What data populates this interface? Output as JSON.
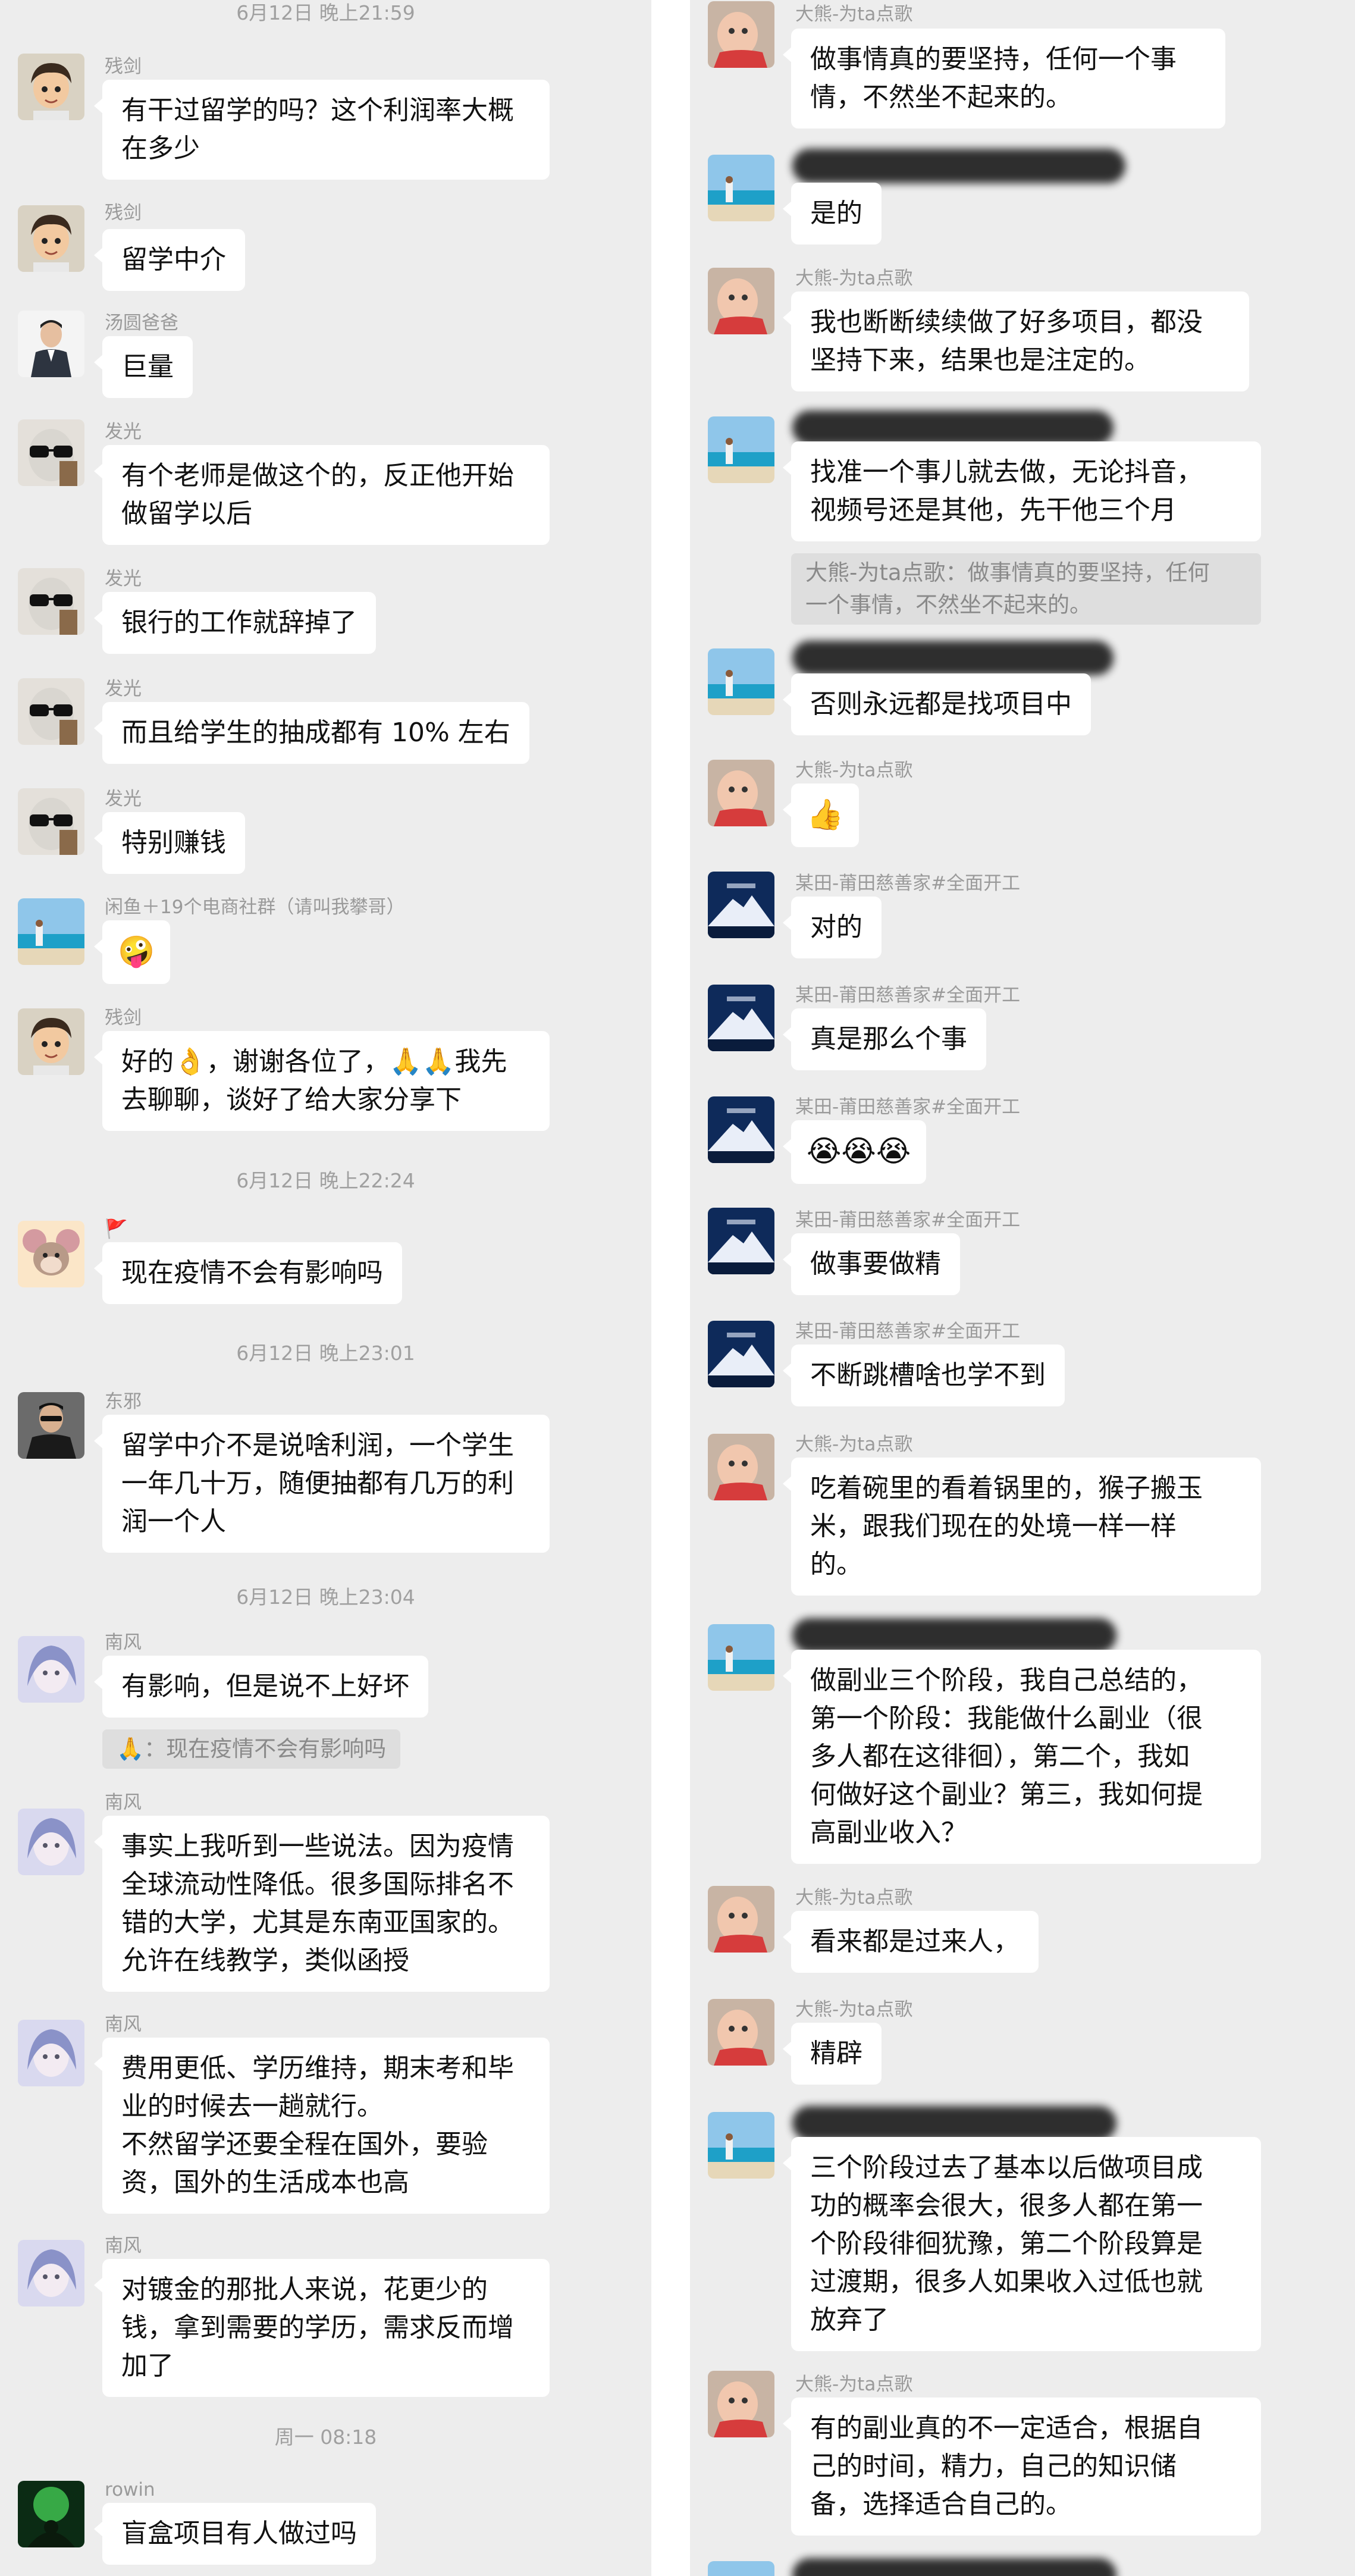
{
  "colors": {
    "background": "#ededed",
    "bubble": "#ffffff",
    "timestamp": "#a0a0a0",
    "name": "#9a9a9a",
    "quote_bg": "#dedede"
  },
  "left": {
    "timestamps": [
      "6月12日 晚上21:59",
      "6月12日 晚上22:24",
      "6月12日 晚上23:01",
      "6月12日 晚上23:04",
      "周一 08:18"
    ],
    "messages": [
      {
        "sender": "残剑",
        "avatar": "cartoon-boy-avatar",
        "lines": [
          "有干过留学的吗？这个利润率大概",
          "在多少"
        ]
      },
      {
        "sender": "残剑",
        "avatar": "cartoon-boy-avatar",
        "lines": [
          "留学中介"
        ]
      },
      {
        "sender": "汤圆爸爸",
        "avatar": "man-in-suit-avatar",
        "lines": [
          "巨量"
        ]
      },
      {
        "sender": "发光",
        "avatar": "sunglasses-avatar",
        "lines": [
          "有个老师是做这个的，反正他开始",
          "做留学以后"
        ]
      },
      {
        "sender": "发光",
        "avatar": "sunglasses-avatar",
        "lines": [
          "银行的工作就辞掉了"
        ]
      },
      {
        "sender": "发光",
        "avatar": "sunglasses-avatar",
        "lines": [
          "而且给学生的抽成都有 10% 左右"
        ]
      },
      {
        "sender": "发光",
        "avatar": "sunglasses-avatar",
        "lines": [
          "特别赚钱"
        ]
      },
      {
        "sender": "闲鱼＋19个电商社群（请叫我攀哥）",
        "avatar": "beach-avatar",
        "emoji": "🤪"
      },
      {
        "sender": "残剑",
        "avatar": "cartoon-boy-avatar",
        "lines": [
          "好的👌，谢谢各位了，🙏🙏我先",
          "去聊聊，谈好了给大家分享下"
        ]
      },
      {
        "sender": "🚩",
        "avatar": "cartoon-mouse-avatar",
        "lines": [
          "现在疫情不会有影响吗"
        ]
      },
      {
        "sender": "东邪",
        "avatar": "man-dark-avatar",
        "lines": [
          "留学中介不是说啥利润，一个学生",
          "一年几十万，随便抽都有几万的利",
          "润一个人"
        ]
      },
      {
        "sender": "南风",
        "avatar": "anime-girl-avatar",
        "lines": [
          "有影响，但是说不上好坏"
        ],
        "quote": "🙏：现在疫情不会有影响吗"
      },
      {
        "sender": "南风",
        "avatar": "anime-girl-avatar",
        "lines": [
          "事实上我听到一些说法。因为疫情",
          "全球流动性降低。很多国际排名不",
          "错的大学，尤其是东南亚国家的。",
          "允许在线教学，类似函授"
        ]
      },
      {
        "sender": "南风",
        "avatar": "anime-girl-avatar",
        "lines": [
          "费用更低、学历维持，期末考和毕",
          "业的时候去一趟就行。",
          "不然留学还要全程在国外，要验",
          "资，国外的生活成本也高"
        ]
      },
      {
        "sender": "南风",
        "avatar": "anime-girl-avatar",
        "lines": [
          "对镀金的那批人来说，花更少的",
          "钱，拿到需要的学历，需求反而增",
          "加了"
        ]
      },
      {
        "sender": "rowin",
        "avatar": "rowin-avatar",
        "lines": [
          "盲盒项目有人做过吗"
        ]
      }
    ]
  },
  "right": {
    "messages": [
      {
        "sender": "大熊-为ta点歌",
        "avatar": "baby-avatar",
        "lines": [
          "做事情真的要坚持，任何一个事",
          "情，不然坐不起来的。"
        ]
      },
      {
        "sender": "",
        "avatar": "beach-avatar",
        "lines": [
          "是的"
        ]
      },
      {
        "sender": "大熊-为ta点歌",
        "avatar": "baby-avatar",
        "lines": [
          "我也断断续续做了好多项目，都没",
          "坚持下来，结果也是注定的。"
        ]
      },
      {
        "sender": "",
        "avatar": "beach-avatar",
        "lines": [
          "找准一个事儿就去做，无论抖音，",
          "视频号还是其他，先干他三个月"
        ],
        "quote_lines": [
          "大熊-为ta点歌：做事情真的要坚持，任何",
          "一个事情，不然坐不起来的。"
        ]
      },
      {
        "sender": "",
        "avatar": "beach-avatar",
        "lines": [
          "否则永远都是找项目中"
        ]
      },
      {
        "sender": "大熊-为ta点歌",
        "avatar": "baby-avatar",
        "emoji": "👍"
      },
      {
        "sender": "某田-莆田慈善家#全面开工",
        "avatar": "mountain-avatar",
        "lines": [
          "对的"
        ]
      },
      {
        "sender": "某田-莆田慈善家#全面开工",
        "avatar": "mountain-avatar",
        "lines": [
          "真是那么个事"
        ]
      },
      {
        "sender": "某田-莆田慈善家#全面开工",
        "avatar": "mountain-avatar",
        "emoji": "😭😭😭"
      },
      {
        "sender": "某田-莆田慈善家#全面开工",
        "avatar": "mountain-avatar",
        "lines": [
          "做事要做精"
        ]
      },
      {
        "sender": "某田-莆田慈善家#全面开工",
        "avatar": "mountain-avatar",
        "lines": [
          "不断跳槽啥也学不到"
        ]
      },
      {
        "sender": "大熊-为ta点歌",
        "avatar": "baby-avatar",
        "lines": [
          "吃着碗里的看着锅里的，猴子搬玉",
          "米，跟我们现在的处境一样一样",
          "的。"
        ]
      },
      {
        "sender": "",
        "avatar": "beach-avatar",
        "lines": [
          "做副业三个阶段，我自己总结的，",
          "第一个阶段：我能做什么副业（很",
          "多人都在这徘徊），第二个，我如",
          "何做好这个副业？第三，我如何提",
          "高副业收入？"
        ]
      },
      {
        "sender": "大熊-为ta点歌",
        "avatar": "baby-avatar",
        "lines": [
          "看来都是过来人，"
        ]
      },
      {
        "sender": "大熊-为ta点歌",
        "avatar": "baby-avatar",
        "lines": [
          "精辟"
        ]
      },
      {
        "sender": "",
        "avatar": "beach-avatar",
        "lines": [
          "三个阶段过去了基本以后做项目成",
          "功的概率会很大，很多人都在第一",
          "个阶段徘徊犹豫，第二个阶段算是",
          "过渡期，很多人如果收入过低也就",
          "放弃了"
        ]
      },
      {
        "sender": "大熊-为ta点歌",
        "avatar": "baby-avatar",
        "lines": [
          "有的副业真的不一定适合，根据自",
          "己的时间，精力，自己的知识储",
          "备，选择适合自己的。"
        ]
      }
    ]
  }
}
